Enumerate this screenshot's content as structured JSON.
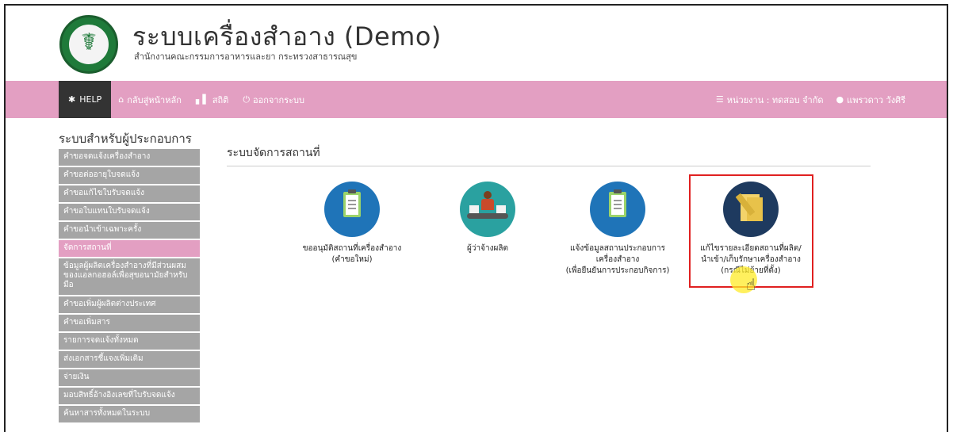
{
  "header": {
    "title": "ระบบเครื่องสำอาง (Demo)",
    "subtitle": "สำนักงานคณะกรรมการอาหารและยา กระทรวงสาธารณสุข",
    "logo_text": "MINISTRY OF PUBLIC HEALTH"
  },
  "navbar": {
    "help_label": "HELP",
    "home_label": "กลับสู่หน้าหลัก",
    "stats_label": "สถิติ",
    "logout_label": "ออกจากระบบ",
    "agency_label": "หน่วยงาน : ทดสอบ จำกัด",
    "user_label": "แพรวดาว วังศิรี",
    "color": "#e39fc2"
  },
  "sidebar": {
    "title": "ระบบสำหรับผู้ประกอบการ",
    "items": [
      {
        "label": "คำขอจดแจ้งเครื่องสำอาง"
      },
      {
        "label": "คำขอต่ออายุใบจดแจ้ง"
      },
      {
        "label": "คำขอแก้ไขใบรับจดแจ้ง"
      },
      {
        "label": "คำขอใบแทนใบรับจดแจ้ง"
      },
      {
        "label": "คำขอนำเข้าเฉพาะครั้ง"
      },
      {
        "label": "จัดการสถานที่"
      },
      {
        "label": "ข้อมูลผู้ผลิตเครื่องสำอางที่มีส่วนผสมของแอลกอฮอล์เพื่อสุขอนามัยสำหรับมือ"
      },
      {
        "label": "คำขอเพิ่มผู้ผลิตต่างประเทศ"
      },
      {
        "label": "คำขอเพิ่มสาร"
      },
      {
        "label": "รายการจดแจ้งทั้งหมด"
      },
      {
        "label": "ส่งเอกสารชี้แจงเพิ่มเติม"
      },
      {
        "label": "จ่ายเงิน"
      },
      {
        "label": "มอบสิทธิ์อ้างอิงเลขที่ใบรับจดแจ้ง"
      },
      {
        "label": "ค้นหาสารทั้งหมดในระบบ"
      }
    ]
  },
  "main": {
    "title": "ระบบจัดการสถานที่",
    "cards": [
      {
        "line1": "ขออนุมัติสถานที่เครื่องสำอาง",
        "line2": "(คำขอใหม่)",
        "line3": "",
        "icon": "clipboard-icon"
      },
      {
        "line1": "ผู้ว่าจ้างผลิต",
        "line2": "",
        "line3": "",
        "icon": "conveyor-worker-icon"
      },
      {
        "line1": "แจ้งข้อมูลสถานประกอบการ",
        "line2": "เครื่องสำอาง",
        "line3": "(เพื่อยืนยันการประกอบกิจการ)",
        "icon": "clipboard-icon"
      },
      {
        "line1": "แก้ไขรายละเอียดสถานที่ผลิต/",
        "line2": "นำเข้า/เก็บรักษาเครื่องสำอาง",
        "line3": "(กรณีไม่ย้ายที่ตั้ง)",
        "icon": "pencil-note-icon"
      }
    ]
  }
}
